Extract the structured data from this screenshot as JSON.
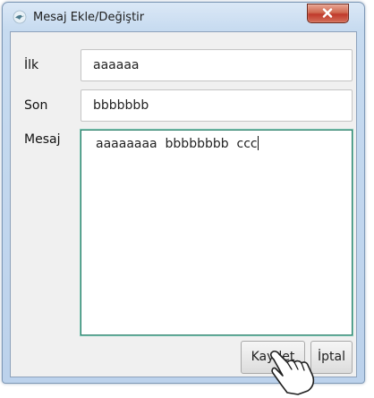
{
  "window": {
    "title": "Mesaj Ekle/Değiştir",
    "app_icon": "bird-icon",
    "close_icon": "close-icon"
  },
  "form": {
    "ilk_label": "İlk",
    "ilk_value": "aaaaaa",
    "son_label": "Son",
    "son_value": "bbbbbbb",
    "mesaj_label": "Mesaj",
    "mesaj_value": "aaaaaaaa  bbbbbbbb  ccc"
  },
  "buttons": {
    "save_label": "Kaydet",
    "cancel_label": "İptal"
  },
  "cursor": {
    "icon": "hand-pointer-icon"
  },
  "colors": {
    "focus_border": "#2e7f6b",
    "close_button": "#c0392b"
  }
}
